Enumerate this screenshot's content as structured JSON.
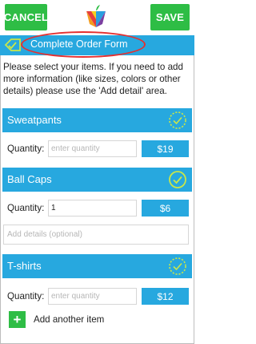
{
  "header": {
    "cancel_label": "CANCEL",
    "save_label": "SAVE",
    "title": "Complete Order Form"
  },
  "intro_text": "Please select your items. If you need to add more information (like sizes, colors or other details) please use the 'Add detail' area.",
  "items": [
    {
      "name": "Sweatpants",
      "quantity_label": "Quantity:",
      "quantity_value": "",
      "quantity_placeholder": "enter quantity",
      "price": "$19",
      "selected": false
    },
    {
      "name": "Ball Caps",
      "quantity_label": "Quantity:",
      "quantity_value": "1",
      "quantity_placeholder": "enter quantity",
      "price": "$6",
      "selected": true,
      "details_placeholder": "Add details (optional)"
    },
    {
      "name": "T-shirts",
      "quantity_label": "Quantity:",
      "quantity_value": "",
      "quantity_placeholder": "enter quantity",
      "price": "$12",
      "selected": false
    }
  ],
  "add_item": {
    "icon": "plus-icon",
    "label": "Add another item"
  },
  "colors": {
    "accent_blue": "#27a8df",
    "action_green": "#2ebd45",
    "check_yellow": "#c8e64a",
    "highlight_red": "#e53030"
  }
}
